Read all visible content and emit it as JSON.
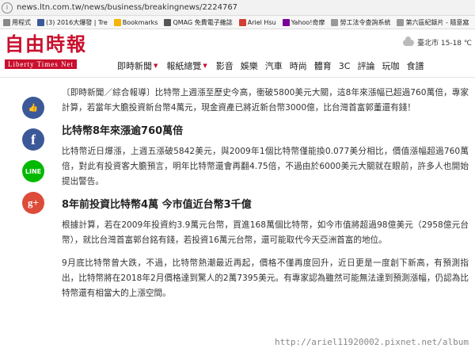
{
  "browser": {
    "url": "news.ltn.com.tw/news/business/breakingnews/2224767"
  },
  "bookmarks": [
    {
      "label": "用程式",
      "color": "#888888"
    },
    {
      "label": "(3) 2016大爆發 | Tre",
      "color": "#3b5998"
    },
    {
      "label": "Bookmarks",
      "color": "#f4b400"
    },
    {
      "label": "QMAG 免費電子雜誌",
      "color": "#555555"
    },
    {
      "label": "Ariel Hsu",
      "color": "#d23f31"
    },
    {
      "label": "Yahoo!奇摩",
      "color": "#7b0099"
    },
    {
      "label": "勞工法令查詢系統",
      "color": "#999999"
    },
    {
      "label": "第六區紀錄片 - 隨意窩",
      "color": "#999999"
    }
  ],
  "header": {
    "logo_cn": "自由時報",
    "logo_en": "Liberty Times Net",
    "weather": "臺北市 15-18 ℃",
    "nav": [
      {
        "label": "即時新聞",
        "caret": "▼"
      },
      {
        "label": "報紙總覽",
        "caret": "▼"
      },
      {
        "label": "影音"
      },
      {
        "label": "娛樂"
      },
      {
        "label": "汽車"
      },
      {
        "label": "時尚"
      },
      {
        "label": "體育"
      },
      {
        "label": "3C"
      },
      {
        "label": "評論"
      },
      {
        "label": "玩咖"
      },
      {
        "label": "食譜"
      }
    ]
  },
  "social": {
    "like": "👍",
    "fb": "f",
    "line": "LINE",
    "gplus": "g+"
  },
  "article": {
    "p1": "〔即時新聞／綜合報導〕比特幣上週漲至歷史今高，衝破5800美元大關，這8年來漲幅已超過760萬倍，專家計算，若當年大膽投資新台幣4萬元，現金資產已將近新台幣3000億，比台灣首富郭董還有錢！",
    "h1": "比特幣8年來漲逾760萬倍",
    "p2": "比特幣近日爆漲，上週五漲破5842美元，與2009年1個比特幣僅能換0.077美分相比，價值漲幅超過760萬倍，對此有投資客大膽預言，明年比特幣還會再翻4.75倍，不過由於6000美元大關就在眼前，許多人也開始提出警告。",
    "h2": "8年前投資比特幣4萬 今市值近台幣3千億",
    "p3": "根據計算，若在2009年投資約3.9萬元台幣，買進168萬個比特幣，如今市值將超過98億美元（2958億元台幣），就比台灣首富郭台銘有錢，若投資16萬元台幣，還可能取代今天亞洲首富的地位。",
    "p4": "9月底比特幣曾大跌，不過，比特幣熱潮最近再起，價格不僅再度回升，近日更是一度創下新高，有預測指出，比特幣將在2018年2月價格達到驚人的2萬7395美元。有專家認為雖然可能無法達到預測漲幅，仍認為比特幣還有相當大的上漲空間。"
  },
  "watermark": "http://ariel11920002.pixnet.net/album"
}
